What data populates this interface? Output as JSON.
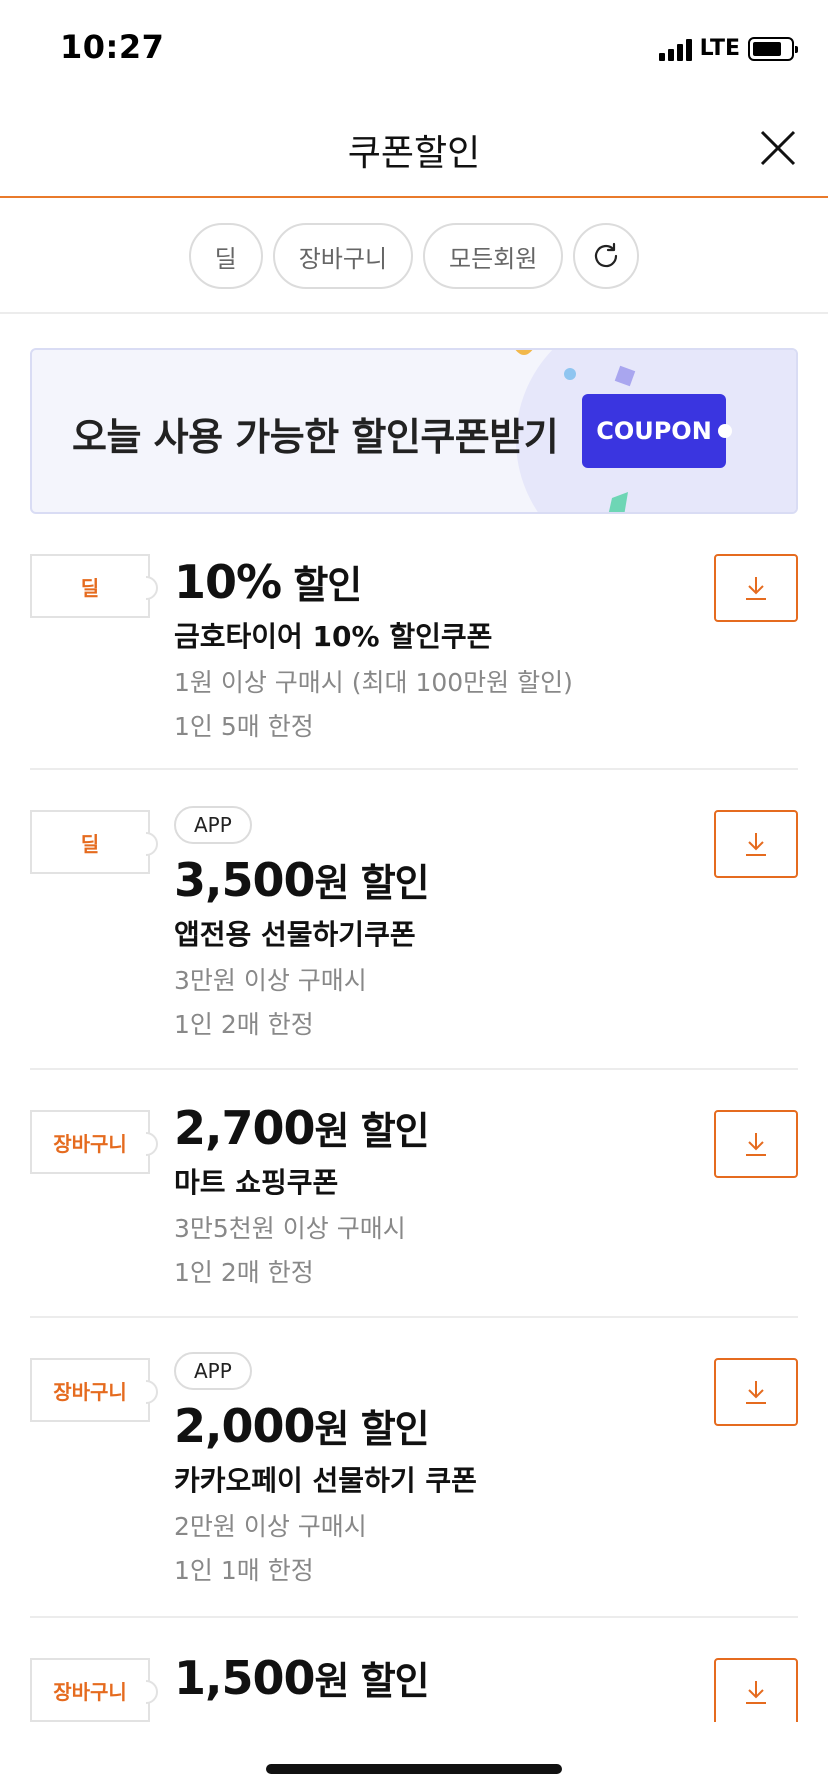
{
  "status_bar": {
    "time": "10:27",
    "network": "LTE"
  },
  "header": {
    "title": "쿠폰할인"
  },
  "filters": [
    {
      "label": "딜"
    },
    {
      "label": "장바구니"
    },
    {
      "label": "모든회원"
    }
  ],
  "banner": {
    "text": "오늘 사용 가능한 할인쿠폰받기",
    "coupon_label": "COUPON"
  },
  "coupons": [
    {
      "tag": "딜",
      "badge": "",
      "amount": "10%",
      "amount_suffix": " 할인",
      "name": "금호타이어 10% 할인쿠폰",
      "condition": "1원 이상 구매시 (최대 100만원 할인)",
      "limit": "1인 5매 한정"
    },
    {
      "tag": "딜",
      "badge": "APP",
      "amount": "3,500",
      "amount_suffix": "원 할인",
      "name": "앱전용 선물하기쿠폰",
      "condition": "3만원 이상 구매시",
      "limit": "1인 2매 한정"
    },
    {
      "tag": "장바구니",
      "badge": "",
      "amount": "2,700",
      "amount_suffix": "원 할인",
      "name": "마트 쇼핑쿠폰",
      "condition": "3만5천원 이상 구매시",
      "limit": "1인 2매 한정"
    },
    {
      "tag": "장바구니",
      "badge": "APP",
      "amount": "2,000",
      "amount_suffix": "원 할인",
      "name": "카카오페이 선물하기 쿠폰",
      "condition": "2만원 이상 구매시",
      "limit": "1인 1매 한정"
    },
    {
      "tag": "장바구니",
      "badge": "",
      "amount": "1,500",
      "amount_suffix": "원 할인",
      "name": "",
      "condition": "",
      "limit": ""
    }
  ],
  "colors": {
    "accent": "#e56b1f",
    "coupon_blue": "#3a35e0"
  },
  "icons": {
    "close": "close-icon",
    "refresh": "refresh-icon",
    "download": "download-icon"
  }
}
